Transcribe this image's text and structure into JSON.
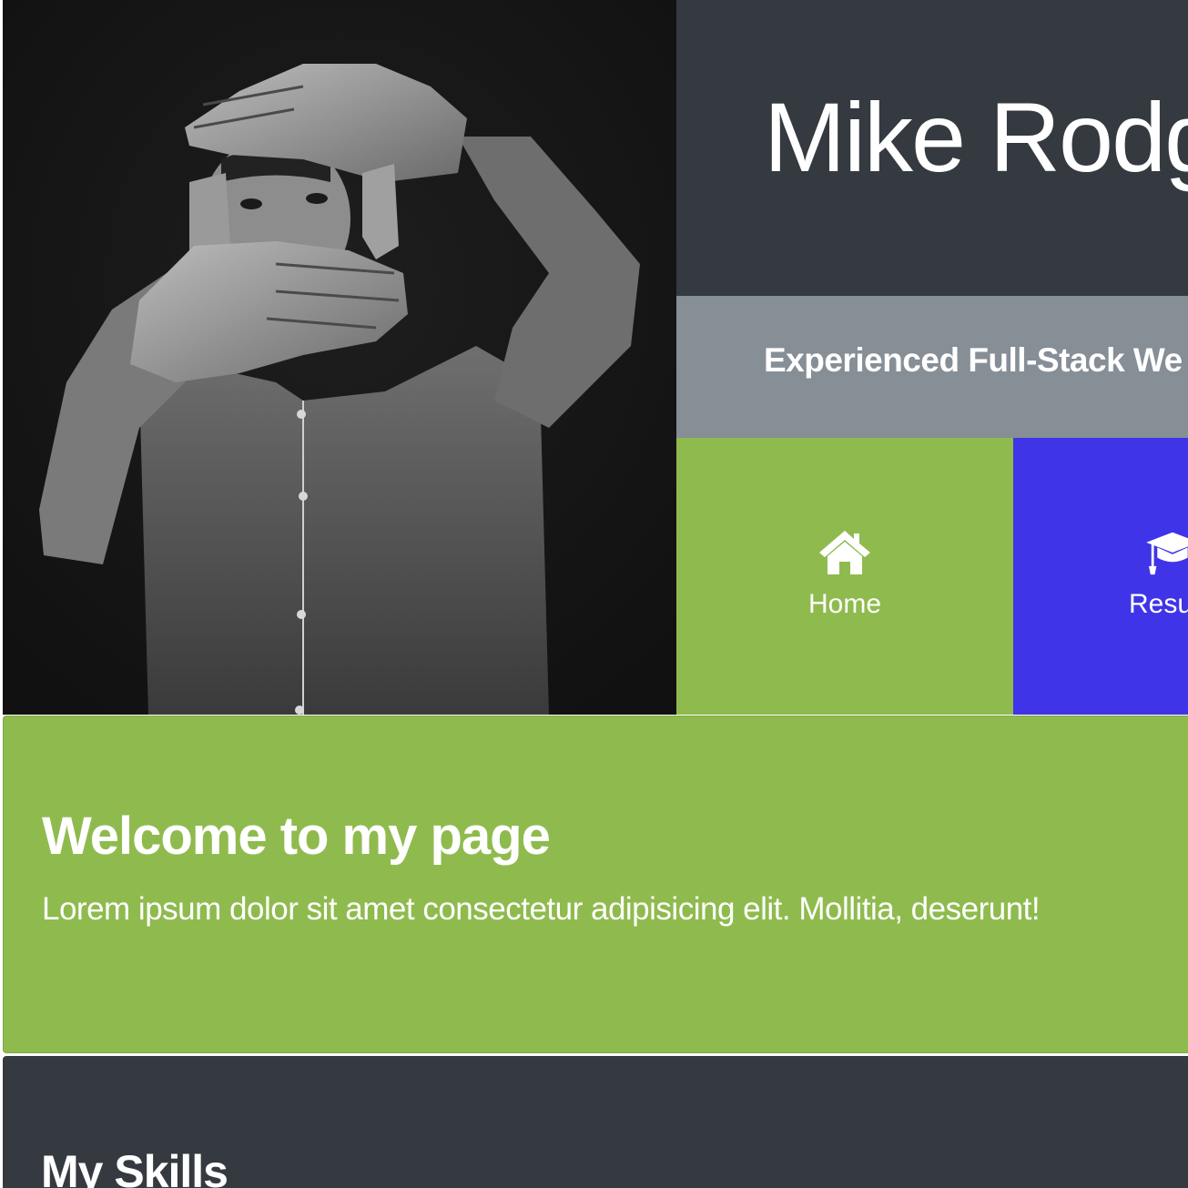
{
  "header": {
    "name": "Mike Rodg",
    "tagline": "Experienced Full-Stack We"
  },
  "nav": {
    "items": [
      {
        "label": "Home",
        "icon": "home-icon",
        "color": "#8fbb4e"
      },
      {
        "label": "Resu",
        "icon": "graduation-cap-icon",
        "color": "#4034e8"
      }
    ]
  },
  "welcome": {
    "title": "Welcome to my page",
    "text": "Lorem ipsum dolor sit amet consectetur adipisicing elit. Mollitia, deserunt!"
  },
  "skills": {
    "title": "My Skills"
  },
  "colors": {
    "dark": "#343a40",
    "gray": "#868e96",
    "green": "#8fbb4e",
    "blue": "#4034e8"
  }
}
